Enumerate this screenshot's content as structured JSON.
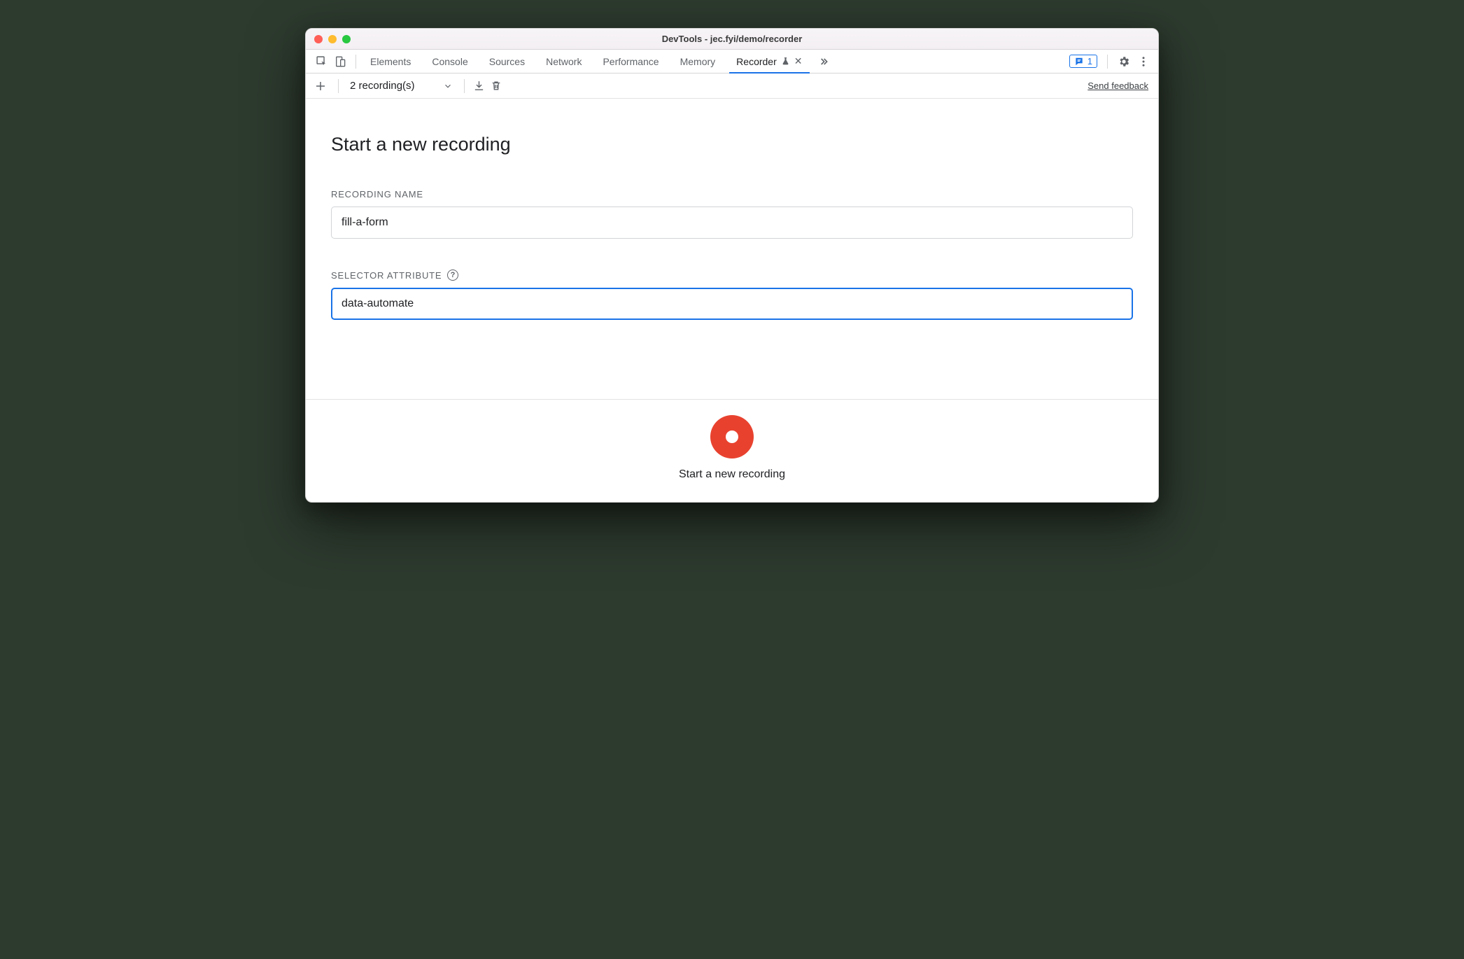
{
  "window": {
    "title": "DevTools - jec.fyi/demo/recorder"
  },
  "tabs": {
    "items": [
      {
        "label": "Elements"
      },
      {
        "label": "Console"
      },
      {
        "label": "Sources"
      },
      {
        "label": "Network"
      },
      {
        "label": "Performance"
      },
      {
        "label": "Memory"
      },
      {
        "label": "Recorder",
        "active": true,
        "experiment": true,
        "closable": true
      }
    ],
    "issues_count": "1"
  },
  "toolbar": {
    "dropdown_label": "2 recording(s)",
    "feedback_label": "Send feedback"
  },
  "main": {
    "heading": "Start a new recording",
    "recording_name_label": "RECORDING NAME",
    "recording_name_value": "fill-a-form",
    "selector_attr_label": "SELECTOR ATTRIBUTE",
    "selector_attr_value": "data-automate"
  },
  "footer": {
    "button_label": "Start a new recording"
  }
}
